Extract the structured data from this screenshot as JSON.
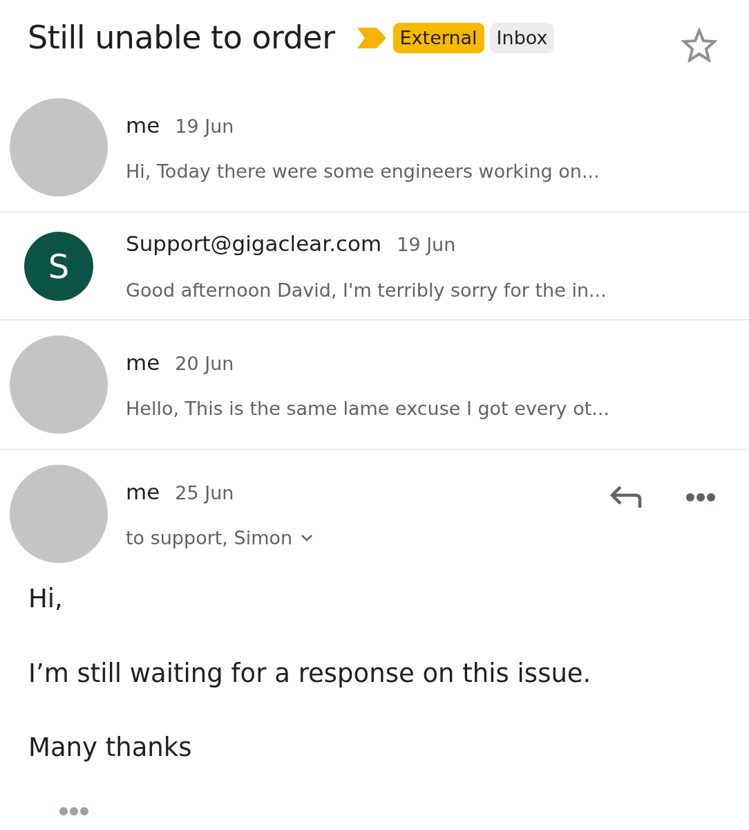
{
  "subject": "Still unable to order",
  "important": true,
  "labels": [
    {
      "text": "External",
      "color": "#f7b800"
    },
    {
      "text": "Inbox",
      "color": "#ececec"
    }
  ],
  "starred": false,
  "messages": [
    {
      "avatar": {
        "kind": "blank"
      },
      "sender": "me",
      "date": "19 Jun",
      "expanded": false,
      "snippet": "Hi, Today there were some engineers working on..."
    },
    {
      "avatar": {
        "kind": "letter",
        "letter": "S",
        "color": "#0b5345"
      },
      "sender": "Support@gigaclear.com",
      "date": "19 Jun",
      "expanded": false,
      "snippet": "Good afternoon David, I'm terribly sorry for the in..."
    },
    {
      "avatar": {
        "kind": "blank"
      },
      "sender": "me",
      "date": "20 Jun",
      "expanded": false,
      "snippet": "Hello, This is the same lame excuse I got every ot..."
    },
    {
      "avatar": {
        "kind": "blank"
      },
      "sender": "me",
      "date": "25 Jun",
      "expanded": true,
      "recipients": "to support, Simon",
      "body": [
        "Hi,",
        "I’m still waiting for a response on this issue.",
        "Many thanks"
      ]
    }
  ]
}
